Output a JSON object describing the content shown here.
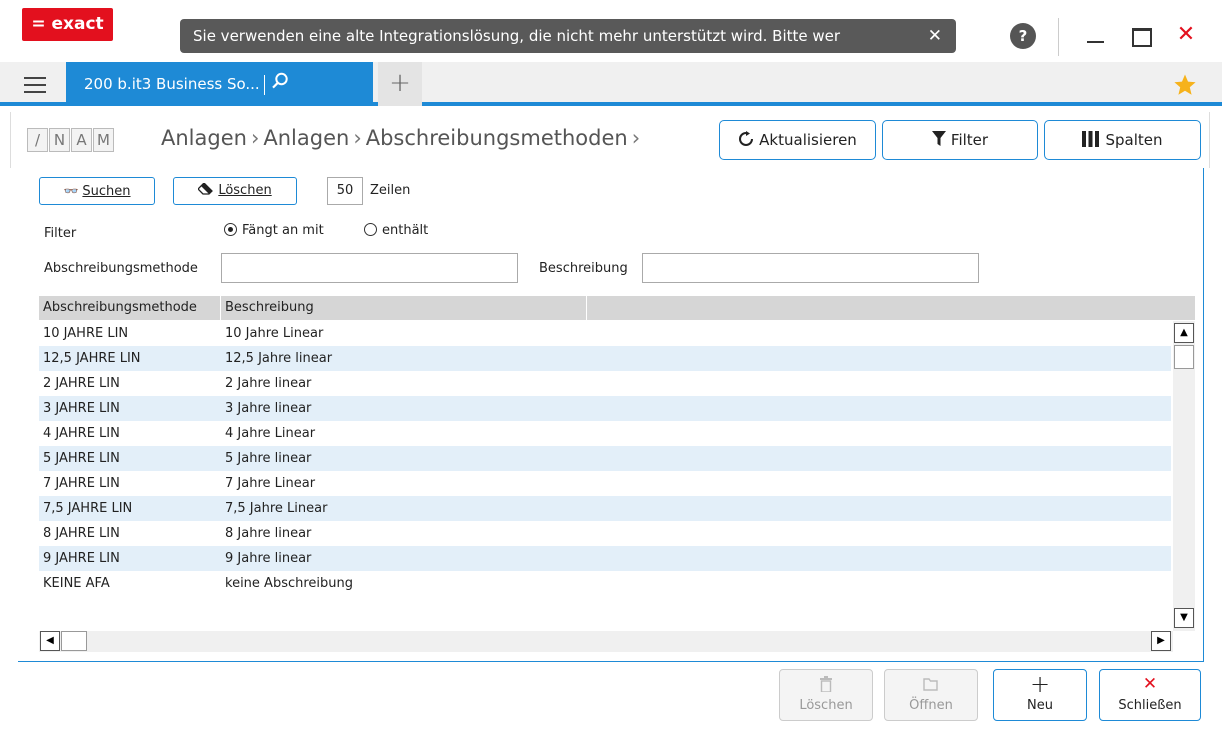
{
  "app": {
    "logo": "= exact"
  },
  "notice": {
    "text": "Sie verwenden eine alte Integrationslösung, die nicht mehr unterstützt wird. Bitte wer",
    "close": "✕"
  },
  "window": {
    "help": "?",
    "close": "✕"
  },
  "tabs": {
    "active_label": "200  b.it3 Business So...",
    "add": "+"
  },
  "shortcuts": [
    "/",
    "N",
    "A",
    "M"
  ],
  "breadcrumb": [
    "Anlagen",
    "Anlagen",
    "Abschreibungsmethoden"
  ],
  "breadcrumb_sep": "›",
  "toolbar": {
    "refresh": "Aktualisieren",
    "filter": "Filter",
    "columns": "Spalten"
  },
  "search": {
    "search_button": "Suchen",
    "clear_button": "Löschen",
    "rows_value": "50",
    "rows_label": "Zeilen",
    "filter_label": "Filter",
    "radio_starts": "Fängt an mit",
    "radio_contains": "enthält",
    "method_label": "Abschreibungsmethode",
    "method_value": "",
    "description_label": "Beschreibung",
    "description_value": ""
  },
  "table": {
    "columns": [
      "Abschreibungsmethode",
      "Beschreibung"
    ],
    "rows": [
      [
        "10 JAHRE LIN",
        "10 Jahre Linear"
      ],
      [
        "12,5 JAHRE LIN",
        "12,5 Jahre linear"
      ],
      [
        "2 JAHRE LIN",
        "2 Jahre linear"
      ],
      [
        "3 JAHRE LIN",
        "3 Jahre linear"
      ],
      [
        "4 JAHRE LIN",
        "4 Jahre Linear"
      ],
      [
        "5 JAHRE LIN",
        "5 Jahre linear"
      ],
      [
        "7 JAHRE LIN",
        "7 Jahre Linear"
      ],
      [
        "7,5 JAHRE LIN",
        "7,5 Jahre Linear"
      ],
      [
        "8 JAHRE LIN",
        "8 Jahre linear"
      ],
      [
        "9 JAHRE LIN",
        "9 Jahre linear"
      ],
      [
        "KEINE AFA",
        "keine Abschreibung"
      ]
    ]
  },
  "footer": {
    "delete": "Löschen",
    "open": "Öffnen",
    "new": "Neu",
    "close": "Schließen"
  },
  "colors": {
    "accent": "#1e8ad6",
    "brand": "#e3101e",
    "row_alt": "#e3eff9"
  }
}
